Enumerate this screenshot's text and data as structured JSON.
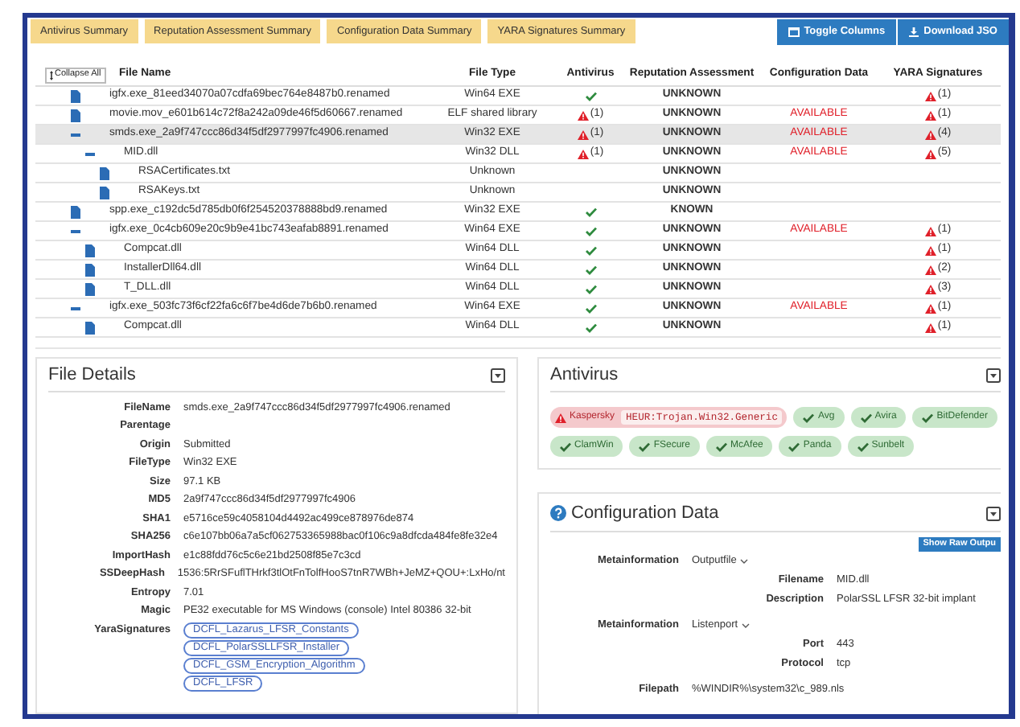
{
  "tabs": [
    {
      "label": "Antivirus Summary"
    },
    {
      "label": "Reputation Assessment Summary"
    },
    {
      "label": "Configuration Data Summary"
    },
    {
      "label": "YARA Signatures Summary"
    }
  ],
  "toolbar_buttons": [
    {
      "label": "Toggle Columns",
      "kind": "columns"
    },
    {
      "label": "Download JSO",
      "kind": "download"
    }
  ],
  "table": {
    "collapse_button": "Collapse All",
    "columns": [
      "File Name",
      "File Type",
      "Antivirus",
      "Reputation Assessment",
      "Configuration Data",
      "YARA Signatures"
    ],
    "rows": [
      {
        "name": "igfx.exe_81eed34070a07cdfa69bec764e8487b0.renamed",
        "type": "Win64 EXE",
        "antivirus": {
          "kind": "clean"
        },
        "reputation": "UNKNOWN",
        "yara": "(1)",
        "selected": false
      },
      {
        "name": "movie.mov_e601b614c72f8a242a09de46f5d60667.renamed",
        "type": "ELF shared library",
        "antivirus": {
          "kind": "detected",
          "count": "(1)"
        },
        "reputation": "UNKNOWN",
        "config": "AVAILABLE",
        "yara": "(1)",
        "selected": false
      },
      {
        "name": "smds.exe_2a9f747ccc86d34f5df2977997fc4906.renamed",
        "type": "Win32 EXE",
        "antivirus": {
          "kind": "detected",
          "count": "(1)"
        },
        "reputation": "UNKNOWN",
        "config": "AVAILABLE",
        "yara": "(4)",
        "selected": true,
        "expanded": true,
        "children": [
          {
            "name": "MID.dll",
            "type": "Win32 DLL",
            "antivirus": {
              "kind": "detected",
              "count": "(1)"
            },
            "reputation": "UNKNOWN",
            "config": "AVAILABLE",
            "yara": "(5)",
            "selected": false,
            "expanded": true,
            "children": [
              {
                "name": "RSACertificates.txt",
                "type": "Unknown",
                "reputation": "UNKNOWN",
                "selected": false
              },
              {
                "name": "RSAKeys.txt",
                "type": "Unknown",
                "reputation": "UNKNOWN",
                "selected": false
              }
            ]
          }
        ]
      },
      {
        "name": "spp.exe_c192dc5d785db0f6f254520378888bd9.renamed",
        "type": "Win32 EXE",
        "antivirus": {
          "kind": "clean"
        },
        "reputation": "KNOWN",
        "selected": false
      },
      {
        "name": "igfx.exe_0c4cb609e20c9b9e41bc743eafab8891.renamed",
        "type": "Win64 EXE",
        "antivirus": {
          "kind": "clean"
        },
        "reputation": "UNKNOWN",
        "config": "AVAILABLE",
        "yara": "(1)",
        "selected": false,
        "expanded": true,
        "children": [
          {
            "name": "Compcat.dll",
            "type": "Win64 DLL",
            "antivirus": {
              "kind": "clean"
            },
            "reputation": "UNKNOWN",
            "yara": "(1)",
            "selected": false
          },
          {
            "name": "InstallerDll64.dll",
            "type": "Win64 DLL",
            "antivirus": {
              "kind": "clean"
            },
            "reputation": "UNKNOWN",
            "yara": "(2)",
            "selected": false
          },
          {
            "name": "T_DLL.dll",
            "type": "Win64 DLL",
            "antivirus": {
              "kind": "clean"
            },
            "reputation": "UNKNOWN",
            "yara": "(3)",
            "selected": false
          }
        ]
      },
      {
        "name": "igfx.exe_503fc73f6cf22fa6c6f7be4d6de7b6b0.renamed",
        "type": "Win64 EXE",
        "antivirus": {
          "kind": "clean"
        },
        "reputation": "UNKNOWN",
        "config": "AVAILABLE",
        "yara": "(1)",
        "selected": false,
        "expanded": true,
        "children": [
          {
            "name": "Compcat.dll",
            "type": "Win64 DLL",
            "antivirus": {
              "kind": "clean"
            },
            "reputation": "UNKNOWN",
            "yara": "(1)",
            "selected": false
          }
        ]
      }
    ]
  },
  "file_details": {
    "title": "File Details",
    "fields": [
      {
        "label": "FileName",
        "value": "smds.exe_2a9f747ccc86d34f5df2977997fc4906.renamed"
      },
      {
        "label": "Parentage"
      },
      {
        "label": "Origin",
        "value": "Submitted"
      },
      {
        "label": "FileType",
        "value": "Win32 EXE"
      },
      {
        "label": "Size",
        "value": "97.1 KB"
      },
      {
        "label": "MD5",
        "value": "2a9f747ccc86d34f5df2977997fc4906"
      },
      {
        "label": "SHA1",
        "value": "e5716ce59c4058104d4492ac499ce878976de874"
      },
      {
        "label": "SHA256",
        "value": "c6e107bb06a7a5cf062753365988bac0f106c9a8dfcda484fe8fe32e4"
      },
      {
        "label": "ImportHash",
        "value": "e1c88fdd76c5c6e21bd2508f85e7c3cd"
      },
      {
        "label": "SSDeepHash",
        "value": "1536:5RrSFuflTHrkf3tlOtFnTolfHooS7tnR7WBh+JeMZ+QOU+:LxHo/nt"
      },
      {
        "label": "Entropy",
        "value": "7.01"
      },
      {
        "label": "Magic",
        "value": "PE32 executable for MS Windows (console) Intel 80386 32-bit"
      }
    ],
    "yara_label": "YaraSignatures",
    "yara_signatures": [
      "DCFL_Lazarus_LFSR_Constants",
      "DCFL_PolarSSLLFSR_Installer",
      "DCFL_GSM_Encryption_Algorithm",
      "DCFL_LFSR"
    ]
  },
  "antivirus": {
    "title": "Antivirus",
    "engines": [
      {
        "name": "Kaspersky",
        "detected": true,
        "result": "HEUR:Trojan.Win32.Generic"
      },
      {
        "name": "Avg",
        "detected": false
      },
      {
        "name": "Avira",
        "detected": false
      },
      {
        "name": "BitDefender",
        "detected": false
      },
      {
        "name": "ClamWin",
        "detected": false
      },
      {
        "name": "FSecure",
        "detected": false
      },
      {
        "name": "McAfee",
        "detected": false
      },
      {
        "name": "Panda",
        "detected": false
      },
      {
        "name": "Sunbelt",
        "detected": false
      }
    ]
  },
  "configuration_data": {
    "title": "Configuration Data",
    "raw_button": "Show Raw Outpu",
    "sections": [
      {
        "label": "Metainformation",
        "value": "Outputfile",
        "fields": [
          {
            "label": "Filename",
            "value": "MID.dll"
          },
          {
            "label": "Description",
            "value": "PolarSSL LFSR 32-bit implant"
          }
        ]
      },
      {
        "label": "Metainformation",
        "value": "Listenport",
        "fields": [
          {
            "label": "Port",
            "value": "443"
          },
          {
            "label": "Protocol",
            "value": "tcp"
          }
        ]
      }
    ],
    "filepath": {
      "label": "Filepath",
      "value": "%WINDIR%\\system32\\c_989.nls"
    }
  }
}
